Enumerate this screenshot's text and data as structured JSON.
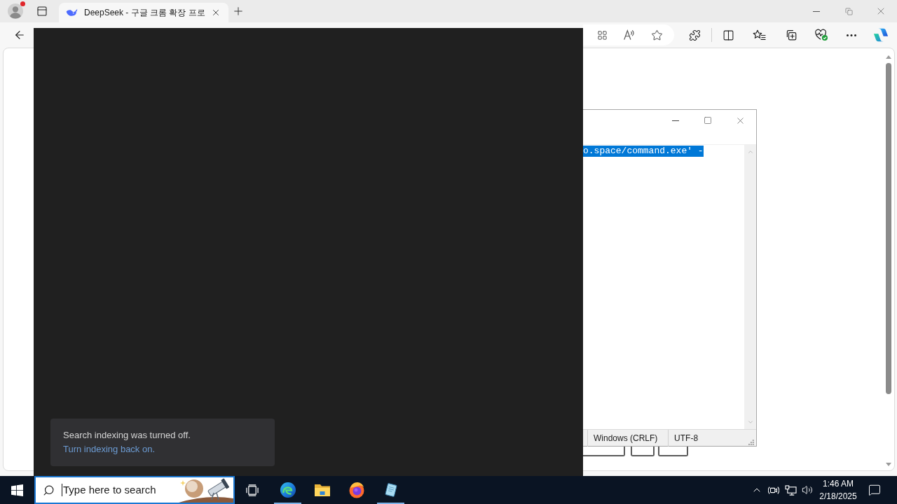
{
  "browser": {
    "profile": {
      "alert": true
    },
    "tabs": [
      {
        "title": "DeepSeek - 구글 크롬 확장 프로",
        "selected": true
      }
    ]
  },
  "notepad": {
    "lines": [
      {
        "text": "o.space/command.exe' -",
        "selected": true
      }
    ],
    "status_bar": [
      "Windows (CRLF)",
      "UTF-8"
    ]
  },
  "search_panel": {
    "notice": {
      "message": "Search indexing was turned off.",
      "link": "Turn indexing back on."
    }
  },
  "taskbar": {
    "search": {
      "placeholder": "Type here to search"
    },
    "apps": [
      {
        "kind": "edge",
        "running": true
      },
      {
        "kind": "explorer",
        "running": false
      },
      {
        "kind": "firefox",
        "running": false
      },
      {
        "kind": "notepad",
        "running": true
      }
    ],
    "clock": {
      "time": "1:46 AM",
      "date": "2/18/2025"
    }
  }
}
